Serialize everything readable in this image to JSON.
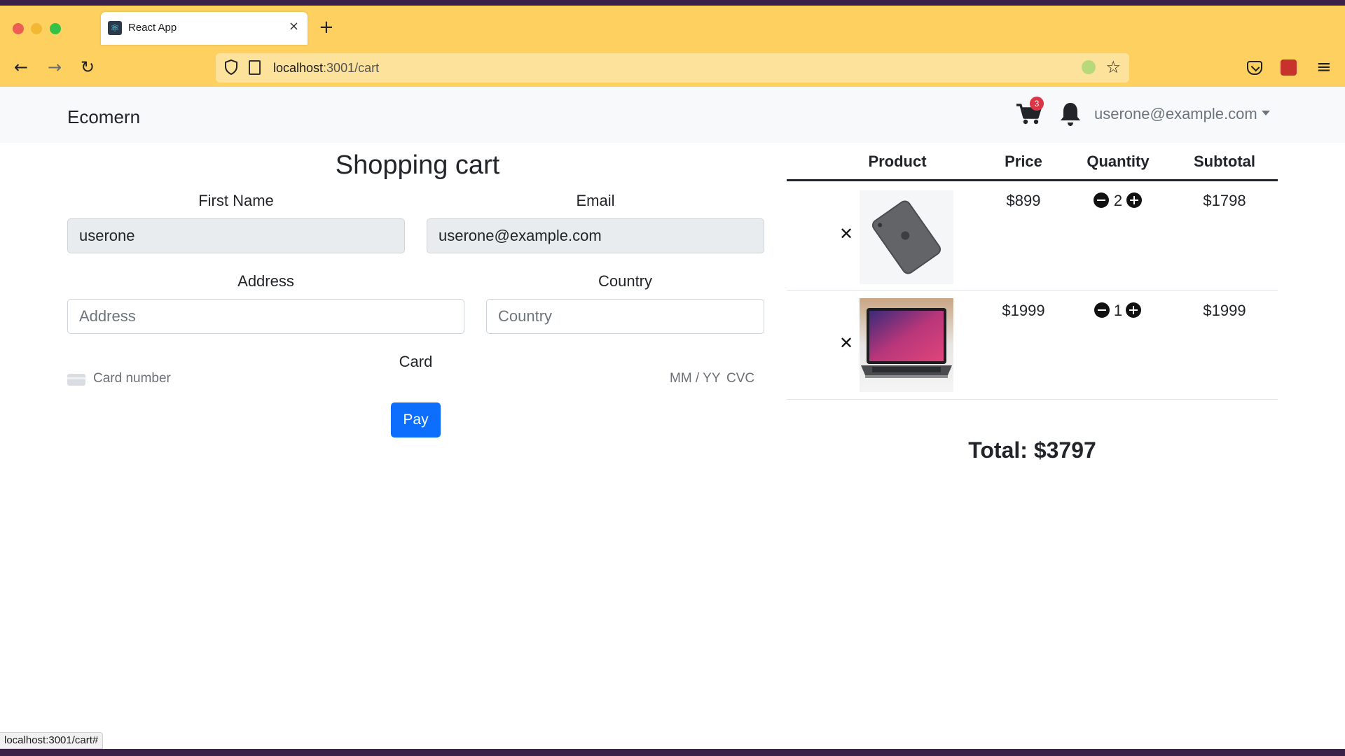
{
  "browser": {
    "tab_title": "React App",
    "tab_close": "×",
    "new_tab": "+",
    "back": "←",
    "forward": "→",
    "reload": "↻",
    "url_host": "localhost",
    "url_path": ":3001/cart",
    "bookmark_star": "☆",
    "menu": "≡",
    "status_url": "localhost:3001/cart#"
  },
  "navbar": {
    "brand": "Ecomern",
    "cart_count": "3",
    "user_email": "userone@example.com"
  },
  "checkout": {
    "heading": "Shopping cart",
    "first_name_label": "First Name",
    "first_name_value": "userone",
    "email_label": "Email",
    "email_value": "userone@example.com",
    "address_label": "Address",
    "address_placeholder": "Address",
    "country_label": "Country",
    "country_placeholder": "Country",
    "card_label": "Card",
    "card_number_placeholder": "Card number",
    "card_expiry_placeholder": "MM / YY",
    "card_cvc_placeholder": "CVC",
    "pay_label": "Pay"
  },
  "cart_table": {
    "headers": {
      "product": "Product",
      "price": "Price",
      "quantity": "Quantity",
      "subtotal": "Subtotal"
    },
    "remove_glyph": "✕",
    "rows": [
      {
        "product": "iPad (space gray)",
        "price": "$899",
        "quantity": "2",
        "subtotal": "$1798"
      },
      {
        "product": "MacBook Pro",
        "price": "$1999",
        "quantity": "1",
        "subtotal": "$1999"
      }
    ],
    "total": "Total: $3797"
  },
  "colors": {
    "browser_toolbar": "#fdd05f",
    "url_bar": "#fce29a",
    "primary_button": "#0d6efd",
    "badge": "#dc3545",
    "navbar_bg": "#f8f9fa"
  },
  "icons": [
    "react-favicon",
    "shield-icon",
    "page-icon",
    "star-icon",
    "pocket-icon",
    "extension-icon",
    "menu-icon",
    "cart-icon",
    "bell-icon",
    "card-icon",
    "remove-icon",
    "minus-icon",
    "plus-icon"
  ]
}
